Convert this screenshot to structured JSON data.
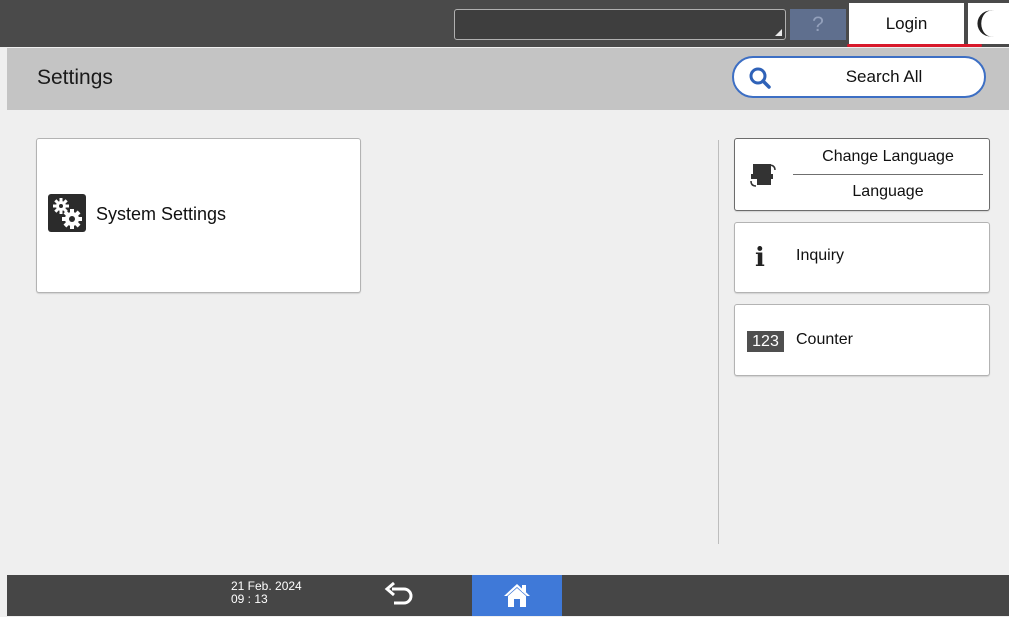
{
  "top_bar": {
    "help_label": "?",
    "login_label": "Login",
    "energy_icon": "crescent-moon-icon"
  },
  "header": {
    "title": "Settings",
    "search_label": "Search All",
    "search_icon": "magnifier-icon"
  },
  "main": {
    "system_settings_label": "System Settings",
    "system_settings_icon": "gears-icon"
  },
  "side_panel": {
    "change_language": {
      "line1": "Change Language",
      "line2": "Language",
      "icon": "language-switch-icon"
    },
    "inquiry": {
      "label": "Inquiry",
      "icon": "info-icon",
      "icon_text": "i"
    },
    "counter": {
      "label": "Counter",
      "icon": "counter-icon",
      "icon_text": "123"
    }
  },
  "bottom_bar": {
    "date": "21 Feb. 2024",
    "time": "09 : 13",
    "back_icon": "back-arrow-icon",
    "home_icon": "home-icon"
  },
  "colors": {
    "accent_blue": "#3f79d8",
    "login_underline": "#d8192b",
    "search_border": "#3d6fc4"
  }
}
